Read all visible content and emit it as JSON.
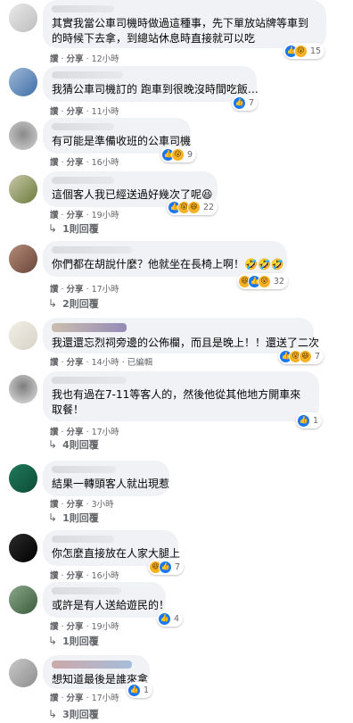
{
  "ui": {
    "dot": "·",
    "reply_arrow_icon": "↳",
    "like_icon": "👍",
    "haha_icon": "😆",
    "wow_icon": "😮"
  },
  "comments": [
    {
      "text": "其實我當公車司機時做過這種事，先下單放站牌等車到的時候下去拿，到總站休息時直接就可以吃",
      "like": "讚",
      "share": "分享",
      "time": "12小時",
      "reactions": [
        "like",
        "wow"
      ],
      "count": "15"
    },
    {
      "text": "我猜公車司機訂的 跑車到很晚沒時間吃飯…",
      "like": "讚",
      "share": "分享",
      "time": "11小時",
      "reactions": [
        "like"
      ],
      "count": "7"
    },
    {
      "text": "有可能是準備收班的公車司機",
      "like": "讚",
      "share": "分享",
      "time": "16小時",
      "reactions": [
        "like",
        "wow"
      ],
      "count": "9"
    },
    {
      "text": "這個客人我已經送過好幾次了呢😆",
      "like": "讚",
      "share": "分享",
      "time": "19小時",
      "reactions": [
        "like",
        "wow",
        "haha"
      ],
      "count": "22",
      "replies": "1則回覆"
    },
    {
      "text": "你們都在胡說什麼？他就坐在長椅上啊！🤣🤣🤣",
      "like": "讚",
      "share": "分享",
      "time": "17小時",
      "reactions": [
        "haha",
        "like",
        "wow"
      ],
      "count": "32",
      "replies": "2則回覆"
    },
    {
      "text": "我還還忘烈祠旁邊的公佈欄，而且是晚上！！還送了二次",
      "like": "讚",
      "share": "分享",
      "time": "14小時",
      "edited": "已編輯",
      "reactions": [
        "like",
        "wow",
        "haha"
      ],
      "count": "7"
    },
    {
      "text": "我也有過在7-11等客人的，然後他從其他地方開車來取餐！",
      "like": "讚",
      "share": "分享",
      "time": "17小時",
      "reactions": [
        "like"
      ],
      "count": "1",
      "replies": "4則回覆"
    },
    {
      "text": "結果一轉頭客人就出現惹",
      "like": "讚",
      "share": "分享",
      "time": "3小時",
      "replies": "1則回覆"
    },
    {
      "text": "你怎麼直接放在人家大腿上",
      "like": "讚",
      "share": "分享",
      "time": "16小時",
      "reactions": [
        "haha",
        "like"
      ],
      "count": "7"
    },
    {
      "text": "或許是有人送給遊民的！",
      "like": "讚",
      "share": "分享",
      "time": "19小時",
      "reactions": [
        "like"
      ],
      "count": "4",
      "replies": "1則回覆"
    },
    {
      "text": "想知道最後是誰來拿",
      "like": "讚",
      "share": "分享",
      "time": "17小時",
      "reactions": [
        "like"
      ],
      "count": "1",
      "replies": "3則回覆"
    }
  ]
}
